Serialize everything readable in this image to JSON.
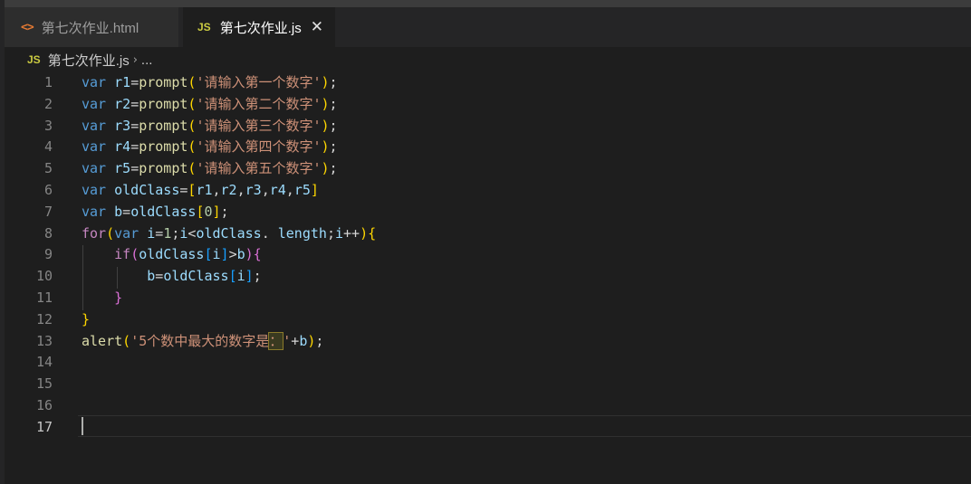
{
  "tabs": [
    {
      "icon": "html-file-icon",
      "label": "第七次作业.html",
      "active": false
    },
    {
      "icon": "js-file-icon",
      "label": "第七次作业.js",
      "active": true
    }
  ],
  "icon_text": {
    "html": "<>",
    "js": "JS",
    "close": "✕",
    "chevron": "›"
  },
  "breadcrumb": {
    "file": "第七次作业.js",
    "more": "..."
  },
  "editor": {
    "line_numbers": [
      "1",
      "2",
      "3",
      "4",
      "5",
      "6",
      "7",
      "8",
      "9",
      "10",
      "11",
      "12",
      "13",
      "14",
      "15",
      "16",
      "17"
    ],
    "active_line": "17",
    "lines": [
      [
        {
          "t": "var",
          "c": "k"
        },
        {
          "t": " r1",
          "c": "v"
        },
        {
          "t": "=",
          "c": "p"
        },
        {
          "t": "prompt",
          "c": "f"
        },
        {
          "t": "(",
          "c": "b1"
        },
        {
          "t": "'请输入第一个数字'",
          "c": "s"
        },
        {
          "t": ")",
          "c": "b1"
        },
        {
          "t": ";",
          "c": "p"
        }
      ],
      [
        {
          "t": "var",
          "c": "k"
        },
        {
          "t": " r2",
          "c": "v"
        },
        {
          "t": "=",
          "c": "p"
        },
        {
          "t": "prompt",
          "c": "f"
        },
        {
          "t": "(",
          "c": "b1"
        },
        {
          "t": "'请输入第二个数字'",
          "c": "s"
        },
        {
          "t": ")",
          "c": "b1"
        },
        {
          "t": ";",
          "c": "p"
        }
      ],
      [
        {
          "t": "var",
          "c": "k"
        },
        {
          "t": " r3",
          "c": "v"
        },
        {
          "t": "=",
          "c": "p"
        },
        {
          "t": "prompt",
          "c": "f"
        },
        {
          "t": "(",
          "c": "b1"
        },
        {
          "t": "'请输入第三个数字'",
          "c": "s"
        },
        {
          "t": ")",
          "c": "b1"
        },
        {
          "t": ";",
          "c": "p"
        }
      ],
      [
        {
          "t": "var",
          "c": "k"
        },
        {
          "t": " r4",
          "c": "v"
        },
        {
          "t": "=",
          "c": "p"
        },
        {
          "t": "prompt",
          "c": "f"
        },
        {
          "t": "(",
          "c": "b1"
        },
        {
          "t": "'请输入第四个数字'",
          "c": "s"
        },
        {
          "t": ")",
          "c": "b1"
        },
        {
          "t": ";",
          "c": "p"
        }
      ],
      [
        {
          "t": "var",
          "c": "k"
        },
        {
          "t": " r5",
          "c": "v"
        },
        {
          "t": "=",
          "c": "p"
        },
        {
          "t": "prompt",
          "c": "f"
        },
        {
          "t": "(",
          "c": "b1"
        },
        {
          "t": "'请输入第五个数字'",
          "c": "s"
        },
        {
          "t": ")",
          "c": "b1"
        },
        {
          "t": ";",
          "c": "p"
        }
      ],
      [
        {
          "t": "var",
          "c": "k"
        },
        {
          "t": " oldClass",
          "c": "v"
        },
        {
          "t": "=",
          "c": "p"
        },
        {
          "t": "[",
          "c": "b1"
        },
        {
          "t": "r1",
          "c": "v"
        },
        {
          "t": ",",
          "c": "p"
        },
        {
          "t": "r2",
          "c": "v"
        },
        {
          "t": ",",
          "c": "p"
        },
        {
          "t": "r3",
          "c": "v"
        },
        {
          "t": ",",
          "c": "p"
        },
        {
          "t": "r4",
          "c": "v"
        },
        {
          "t": ",",
          "c": "p"
        },
        {
          "t": "r5",
          "c": "v"
        },
        {
          "t": "]",
          "c": "b1"
        }
      ],
      [
        {
          "t": "var",
          "c": "k"
        },
        {
          "t": " b",
          "c": "v"
        },
        {
          "t": "=",
          "c": "p"
        },
        {
          "t": "oldClass",
          "c": "v"
        },
        {
          "t": "[",
          "c": "b1"
        },
        {
          "t": "0",
          "c": "n"
        },
        {
          "t": "]",
          "c": "b1"
        },
        {
          "t": ";",
          "c": "p"
        }
      ],
      [
        {
          "t": "for",
          "c": "kc"
        },
        {
          "t": "(",
          "c": "b1"
        },
        {
          "t": "var",
          "c": "k"
        },
        {
          "t": " i",
          "c": "v"
        },
        {
          "t": "=",
          "c": "p"
        },
        {
          "t": "1",
          "c": "n"
        },
        {
          "t": ";",
          "c": "p"
        },
        {
          "t": "i",
          "c": "v"
        },
        {
          "t": "<",
          "c": "p"
        },
        {
          "t": "oldClass",
          "c": "v"
        },
        {
          "t": ". ",
          "c": "p"
        },
        {
          "t": "length",
          "c": "v"
        },
        {
          "t": ";",
          "c": "p"
        },
        {
          "t": "i",
          "c": "v"
        },
        {
          "t": "++",
          "c": "p"
        },
        {
          "t": ")",
          "c": "b1"
        },
        {
          "t": "{",
          "c": "b1"
        }
      ],
      [
        {
          "t": "    ",
          "c": "p"
        },
        {
          "t": "if",
          "c": "kc"
        },
        {
          "t": "(",
          "c": "b2"
        },
        {
          "t": "oldClass",
          "c": "v"
        },
        {
          "t": "[",
          "c": "b3"
        },
        {
          "t": "i",
          "c": "v"
        },
        {
          "t": "]",
          "c": "b3"
        },
        {
          "t": ">",
          "c": "p"
        },
        {
          "t": "b",
          "c": "v"
        },
        {
          "t": ")",
          "c": "b2"
        },
        {
          "t": "{",
          "c": "b2"
        }
      ],
      [
        {
          "t": "        ",
          "c": "p"
        },
        {
          "t": "b",
          "c": "v"
        },
        {
          "t": "=",
          "c": "p"
        },
        {
          "t": "oldClass",
          "c": "v"
        },
        {
          "t": "[",
          "c": "b3"
        },
        {
          "t": "i",
          "c": "v"
        },
        {
          "t": "]",
          "c": "b3"
        },
        {
          "t": ";",
          "c": "p"
        }
      ],
      [
        {
          "t": "    ",
          "c": "p"
        },
        {
          "t": "}",
          "c": "b2"
        }
      ],
      [
        {
          "t": "}",
          "c": "b1"
        }
      ],
      [
        {
          "t": "alert",
          "c": "f"
        },
        {
          "t": "(",
          "c": "b1"
        },
        {
          "t": "'5个数中最大的数字是",
          "c": "s"
        },
        {
          "t": "：",
          "c": "s hl"
        },
        {
          "t": "'",
          "c": "s"
        },
        {
          "t": "+",
          "c": "p"
        },
        {
          "t": "b",
          "c": "v"
        },
        {
          "t": ")",
          "c": "b1"
        },
        {
          "t": ";",
          "c": "p"
        }
      ],
      [],
      [],
      [],
      []
    ]
  }
}
